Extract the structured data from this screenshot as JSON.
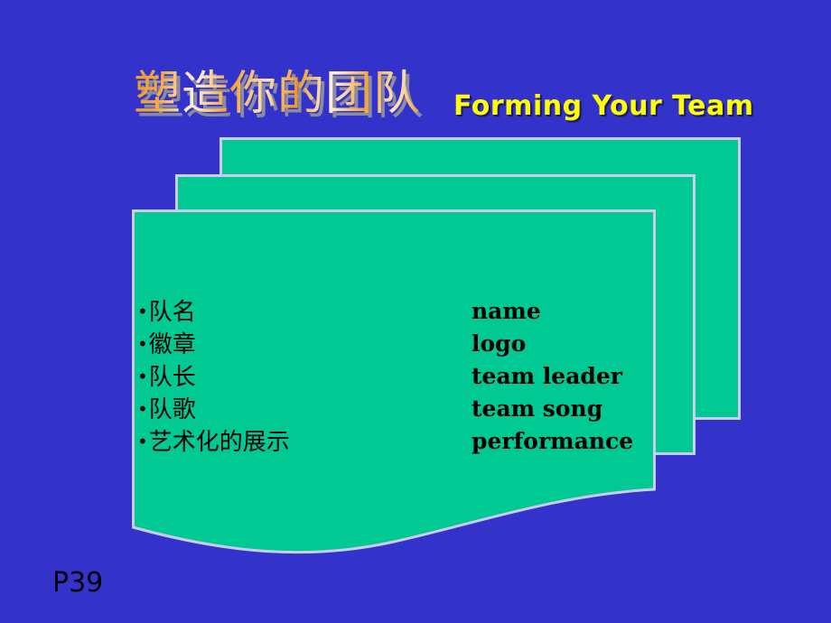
{
  "slide": {
    "background_color": "#3333cc",
    "panel_color": "#00c994",
    "panel_border_color": "#ccccee",
    "title_cn": "塑造你的团队",
    "title_en": "Forming Your Team",
    "title_en_color": "#ffff00",
    "page_label": "P39"
  },
  "items": [
    {
      "cn": "队名",
      "en": "name"
    },
    {
      "cn": "徽章",
      "en": "logo"
    },
    {
      "cn": "队长",
      "en": "team leader"
    },
    {
      "cn": "队歌",
      "en": "team song"
    },
    {
      "cn": "艺术化的展示",
      "en": "performance"
    }
  ],
  "bullet_glyph": "•"
}
